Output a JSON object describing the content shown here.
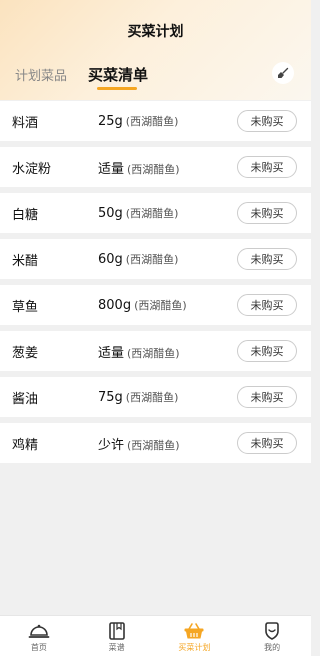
{
  "header": {
    "title": "买菜计划",
    "tabs": [
      "计划菜品",
      "买菜清单"
    ],
    "active_tab": 1,
    "clear_icon": "broom-icon"
  },
  "items": [
    {
      "name": "料酒",
      "amount": "25g",
      "dish": "(西湖醋鱼)",
      "status": "未购买"
    },
    {
      "name": "水淀粉",
      "amount": "适量",
      "dish": "(西湖醋鱼)",
      "status": "未购买"
    },
    {
      "name": "白糖",
      "amount": "50g",
      "dish": "(西湖醋鱼)",
      "status": "未购买"
    },
    {
      "name": "米醋",
      "amount": "60g",
      "dish": "(西湖醋鱼)",
      "status": "未购买"
    },
    {
      "name": "草鱼",
      "amount": "800g",
      "dish": "(西湖醋鱼)",
      "status": "未购买"
    },
    {
      "name": "葱姜",
      "amount": "适量",
      "dish": "(西湖醋鱼)",
      "status": "未购买"
    },
    {
      "name": "酱油",
      "amount": "75g",
      "dish": "(西湖醋鱼)",
      "status": "未购买"
    },
    {
      "name": "鸡精",
      "amount": "少许",
      "dish": "(西湖醋鱼)",
      "status": "未购买"
    }
  ],
  "tabbar": [
    {
      "label": "首页",
      "icon": "home-cloche-icon"
    },
    {
      "label": "菜谱",
      "icon": "recipe-book-icon"
    },
    {
      "label": "买菜计划",
      "icon": "basket-icon",
      "active": true
    },
    {
      "label": "我的",
      "icon": "profile-icon"
    }
  ],
  "colors": {
    "accent": "#f5a623",
    "background": "#f0f0f0"
  }
}
